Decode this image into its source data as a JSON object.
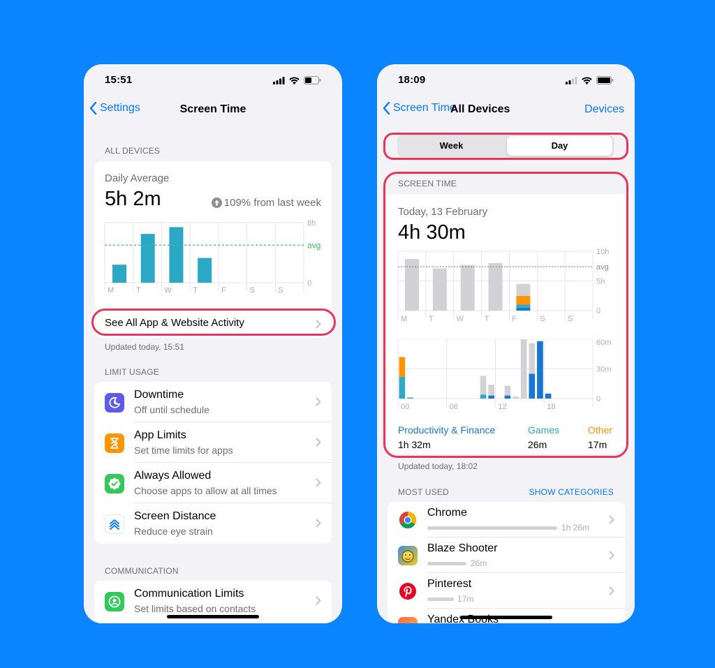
{
  "left": {
    "status_time": "15:51",
    "nav": {
      "back": "Settings",
      "title": "Screen Time"
    },
    "section_all_devices": "ALL DEVICES",
    "summary": {
      "label": "Daily Average",
      "value": "5h 2m",
      "change": "109% from last week"
    },
    "chart_data": {
      "type": "bar",
      "categories": [
        "M",
        "T",
        "W",
        "T",
        "F",
        "S",
        "S"
      ],
      "values": [
        2.4,
        6.5,
        7.4,
        3.3,
        0,
        0,
        0
      ],
      "ylim": [
        0,
        8
      ],
      "y_tick_labels": [
        "8h",
        "0"
      ],
      "avg_label": "avg",
      "avg_value": 5.0,
      "bar_color": "#2ba8c5",
      "avg_color": "#34c759"
    },
    "see_all": "See All App & Website Activity",
    "updated": "Updated today, 15:51",
    "section_limit": "LIMIT USAGE",
    "limit_items": [
      {
        "title": "Downtime",
        "subtitle": "Off until schedule",
        "icon": "moon-clock-icon",
        "color": "#5e5ce6"
      },
      {
        "title": "App Limits",
        "subtitle": "Set time limits for apps",
        "icon": "hourglass-icon",
        "color": "#ff9500"
      },
      {
        "title": "Always Allowed",
        "subtitle": "Choose apps to allow at all times",
        "icon": "checkmark-shield-icon",
        "color": "#34c759"
      },
      {
        "title": "Screen Distance",
        "subtitle": "Reduce eye strain",
        "icon": "chevrons-up-icon",
        "color": "#007aff"
      }
    ],
    "section_comm": "COMMUNICATION",
    "comm_item": {
      "title": "Communication Limits",
      "subtitle": "Set limits based on contacts",
      "icon": "person-circle-icon",
      "color": "#34c759"
    }
  },
  "right": {
    "status_time": "18:09",
    "nav": {
      "back": "Screen Time",
      "title": "All Devices",
      "right": "Devices"
    },
    "segment": {
      "week": "Week",
      "day": "Day",
      "selected": "Day"
    },
    "section_screen_time": "SCREEN TIME",
    "summary": {
      "date": "Today, 13 February",
      "value": "4h 30m"
    },
    "week_chart": {
      "type": "bar",
      "categories": [
        "M",
        "T",
        "W",
        "T",
        "F",
        "S",
        "S"
      ],
      "values": [
        8.7,
        7.1,
        7.7,
        8.0,
        4.5,
        0,
        0
      ],
      "today_breakdown": {
        "productivity": 0.5,
        "games": 0.5,
        "other": 1.5,
        "rest": 2.0
      },
      "ylim": [
        0,
        10
      ],
      "y_tick_labels": [
        "10h",
        "5h",
        "0"
      ],
      "avg_label": "avg",
      "avg_value": 7.4
    },
    "day_chart": {
      "type": "bar",
      "x_labels": [
        "00",
        "06",
        "12",
        "18"
      ],
      "y_tick_labels": [
        "60m",
        "30m",
        "0"
      ],
      "ylim": [
        0,
        60
      ],
      "hours": [
        {
          "h": 0,
          "total": 42,
          "prod": 0,
          "games": 22,
          "other": 20
        },
        {
          "h": 1,
          "total": 1,
          "prod": 0,
          "games": 1,
          "other": 0
        },
        {
          "h": 10,
          "total": 23,
          "prod": 0,
          "games": 4,
          "other": 0
        },
        {
          "h": 11,
          "total": 14,
          "prod": 3,
          "games": 0,
          "other": 0
        },
        {
          "h": 13,
          "total": 13,
          "prod": 3,
          "games": 0,
          "other": 0
        },
        {
          "h": 14,
          "total": 2,
          "prod": 0,
          "games": 0,
          "other": 0
        },
        {
          "h": 15,
          "total": 60,
          "prod": 0,
          "games": 0,
          "other": 0
        },
        {
          "h": 16,
          "total": 56,
          "prod": 25,
          "games": 0,
          "other": 0
        },
        {
          "h": 17,
          "total": 58,
          "prod": 58,
          "games": 0,
          "other": 0
        },
        {
          "h": 18,
          "total": 5,
          "prod": 5,
          "games": 0,
          "other": 0
        }
      ]
    },
    "categories": [
      {
        "name": "Productivity & Finance",
        "value": "1h 32m",
        "color": "#1976d2"
      },
      {
        "name": "Games",
        "value": "26m",
        "color": "#30a9c4"
      },
      {
        "name": "Other",
        "value": "17m",
        "color": "#ff9500"
      }
    ],
    "updated": "Updated today, 18:02",
    "section_most_used": "MOST USED",
    "show_categories": "SHOW CATEGORIES",
    "apps": [
      {
        "name": "Chrome",
        "time": "1h 26m",
        "fraction": 1.0,
        "icon": "chrome-icon"
      },
      {
        "name": "Blaze Shooter",
        "time": "26m",
        "fraction": 0.3,
        "icon": "blaze-shooter-icon"
      },
      {
        "name": "Pinterest",
        "time": "17m",
        "fraction": 0.2,
        "icon": "pinterest-icon"
      },
      {
        "name": "Yandex Books",
        "time": "",
        "fraction": 0,
        "icon": "yandex-books-icon"
      }
    ]
  }
}
